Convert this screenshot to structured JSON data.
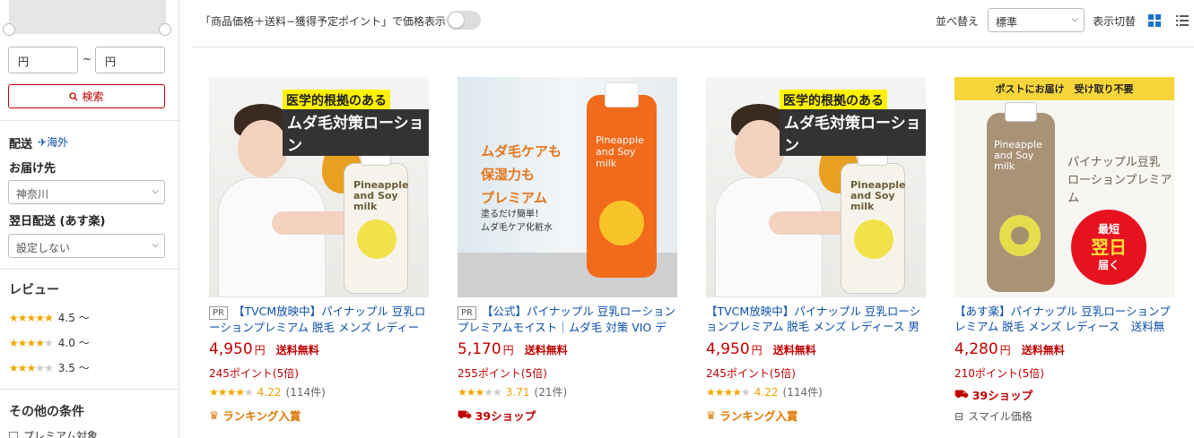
{
  "sidebar": {
    "price_min_placeholder": "円",
    "price_tilde": "~",
    "price_max_placeholder": "円",
    "search_button": "検索",
    "delivery_label": "配送",
    "overseas_label": "海外",
    "destination_label": "お届け先",
    "destination_value": "神奈川",
    "next_day_label": "翌日配送 (あす楽)",
    "next_day_value": "設定しない",
    "review_title": "レビュー",
    "reviews": [
      {
        "stars": "★★★★★",
        "empty": "",
        "label": "4.5 ～"
      },
      {
        "stars": "★★★★",
        "empty": "★",
        "label": "4.0 ～"
      },
      {
        "stars": "★★★",
        "empty": "★★",
        "label": "3.5 ～"
      }
    ],
    "other_title": "その他の条件",
    "premium_label": "プレミアム対象"
  },
  "topbar": {
    "price_display_text": "「商品価格＋送料−獲得予定ポイント」で価格表示",
    "sort_label": "並べ替え",
    "sort_value": "標準",
    "view_label": "表示切替"
  },
  "products": [
    {
      "pr": "PR",
      "title": "【TVCM放映中】パイナップル 豆乳ローションプレミアム 脱毛 メンズ レディース",
      "price": "4,950",
      "yen": "円",
      "shipping": "送料無料",
      "points": "245ポイント(5倍)",
      "stars": "★★★★",
      "stars_empty": "★",
      "score": "4.22",
      "count": "(114件)",
      "badge": "ランキング入賞",
      "image": {
        "banner1": "医学的根拠のある",
        "banner2": "ムダ毛対策ローション",
        "bottle_text": "Pineapple and Soy milk"
      }
    },
    {
      "pr": "PR",
      "title": "【公式】パイナップル 豆乳ローションプレミアムモイスト｜ムダ毛 対策 VIO デリケートゾーン",
      "price": "5,170",
      "yen": "円",
      "shipping": "送料無料",
      "points": "255ポイント(5倍)",
      "stars": "★★★",
      "stars_empty": "★★",
      "score": "3.71",
      "count": "(21件)",
      "badge": "39ショップ",
      "image": {
        "copy1": "ムダ毛ケアも",
        "copy2": "保湿力も",
        "copy3": "プレミアム",
        "sub1": "塗るだけ簡単！",
        "sub2": "ムダ毛ケア化粧水",
        "bottle_text": "Pineapple and Soy milk"
      }
    },
    {
      "pr": "",
      "title": "【TVCM放映中】パイナップル 豆乳ローションプレミアム 脱毛 メンズ レディース 男性 女性",
      "price": "4,950",
      "yen": "円",
      "shipping": "送料無料",
      "points": "245ポイント(5倍)",
      "stars": "★★★★",
      "stars_empty": "★",
      "score": "4.22",
      "count": "(114件)",
      "badge": "ランキング入賞",
      "image": {
        "banner1": "医学的根拠のある",
        "banner2": "ムダ毛対策ローション",
        "bottle_text": "Pineapple and Soy milk"
      }
    },
    {
      "pr": "",
      "title": "【あす楽】パイナップル 豆乳ローションプレミアム 脱毛 メンズ レディース　送料無料",
      "price": "4,280",
      "yen": "円",
      "shipping": "送料無料",
      "points": "210ポイント(5倍)",
      "badge": "39ショップ",
      "smile": "スマイル価格",
      "image": {
        "post_banner": "ポストにお届け　受け取り不要",
        "copy1": "パイナップル豆乳",
        "copy2": "ローションプレミアム",
        "burst1": "最短",
        "burst2": "翌日",
        "burst3": "届く",
        "bottle_text": "Pineapple and Soy milk"
      }
    }
  ]
}
